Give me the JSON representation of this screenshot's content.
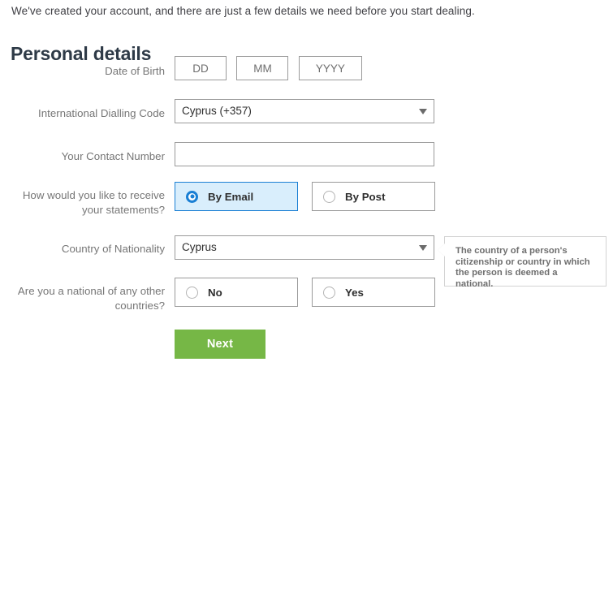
{
  "intro": {
    "text": "We've created your account, and there are just a few details we need before you start dealing."
  },
  "page_title": "Personal details",
  "form": {
    "date_of_birth": {
      "label": "Date of Birth",
      "day_placeholder": "DD",
      "day_value": "",
      "month_placeholder": "MM",
      "month_value": "",
      "year_placeholder": "YYYY",
      "year_value": ""
    },
    "dialling_code": {
      "label": "International Dialling Code",
      "selected": "Cyprus (+357)"
    },
    "contact_number": {
      "label": "Your Contact Number",
      "value": "",
      "placeholder": ""
    },
    "statements": {
      "label": "How would you like to receive your statements?",
      "options": [
        {
          "label": "By Email",
          "selected": true
        },
        {
          "label": "By Post",
          "selected": false
        }
      ]
    },
    "nationality": {
      "label": "Country of Nationality",
      "selected": "Cyprus"
    },
    "other_nationalities": {
      "label": "Are you a national of any other countries?",
      "options": [
        {
          "label": "No",
          "selected": false
        },
        {
          "label": "Yes",
          "selected": false
        }
      ]
    }
  },
  "tooltip": {
    "text": "The country of a person's citizenship or country in which the person is deemed a national."
  },
  "next_button": {
    "label": "Next"
  },
  "colors": {
    "accent_blue": "#1a7fd4",
    "selected_fill": "#d9eefc",
    "button_green": "#76b746",
    "label_gray": "#767676",
    "border_gray": "#9a9a9a"
  }
}
